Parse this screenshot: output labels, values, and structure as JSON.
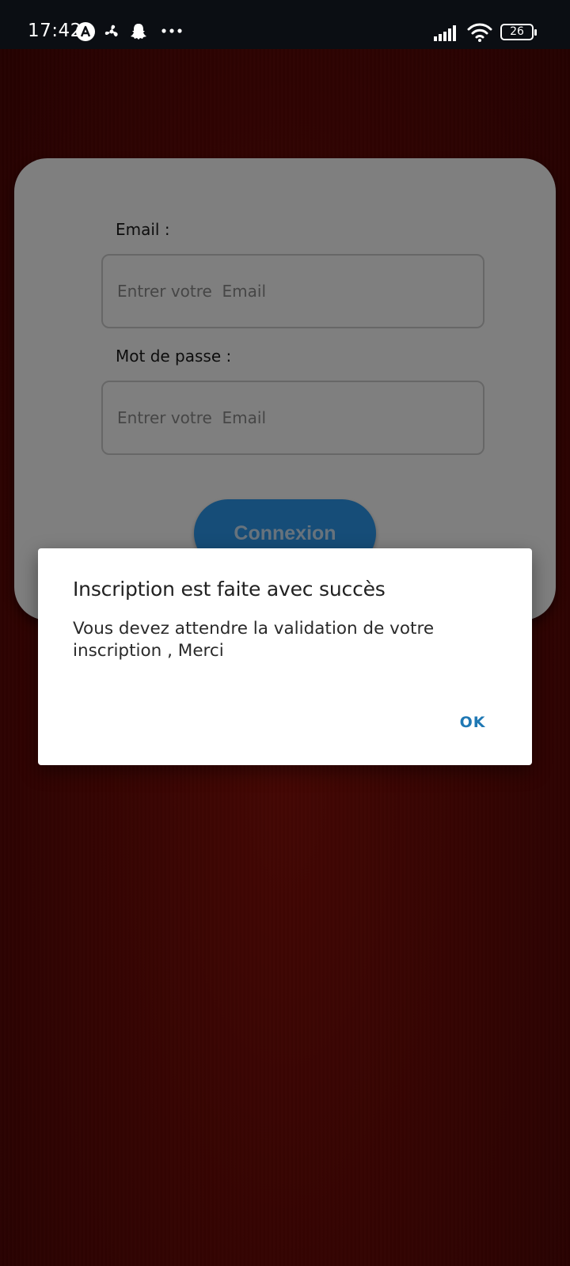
{
  "status_bar": {
    "time": "17:42",
    "battery": "26",
    "icons": [
      "a-circle-icon",
      "fan-icon",
      "snapchat-ghost-icon",
      "more-dots-icon",
      "signal-icon",
      "wifi-icon",
      "battery-icon"
    ]
  },
  "login_form": {
    "email_label": "Email :",
    "email_placeholder": "Entrer votre  Email",
    "password_label": "Mot de passe :",
    "password_placeholder": "Entrer votre  Email",
    "submit_label": "Connexion"
  },
  "dialog": {
    "title": "Inscription est faite avec succès",
    "message": "Vous devez attendre la validation de votre inscription , Merci",
    "ok_label": "OK"
  },
  "colors": {
    "background": "#6c0905",
    "card": "#ffffff",
    "button": "#2d9bf0",
    "dialog_action": "#1f78b4"
  }
}
